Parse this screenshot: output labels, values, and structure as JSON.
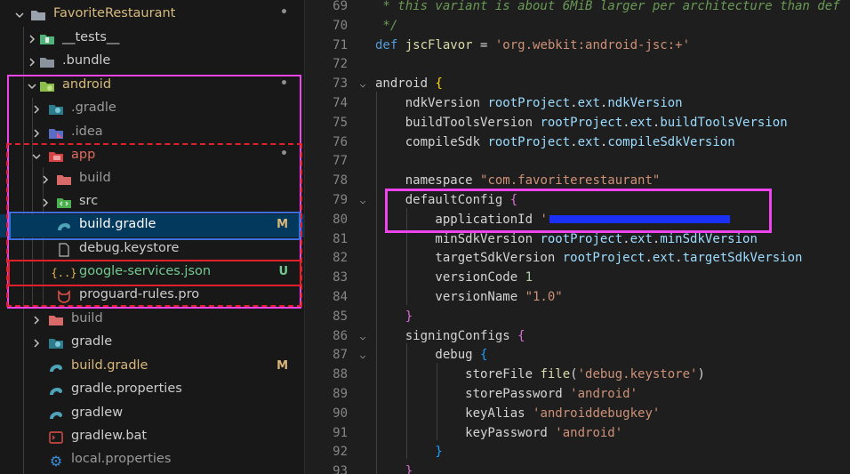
{
  "explorer": {
    "items": [
      {
        "label": "FavoriteRestaurant",
        "icon": "folder-open-icon",
        "status": "•"
      },
      {
        "label": "__tests__",
        "icon": "test-folder-icon",
        "status": ""
      },
      {
        "label": ".bundle",
        "icon": "folder-icon",
        "status": ""
      },
      {
        "label": "android",
        "icon": "android-folder-icon",
        "status": "•"
      },
      {
        "label": ".gradle",
        "icon": "gradle-folder-icon",
        "status": ""
      },
      {
        "label": ".idea",
        "icon": "idea-folder-icon",
        "status": ""
      },
      {
        "label": "app",
        "icon": "app-folder-icon",
        "status": "•"
      },
      {
        "label": "build",
        "icon": "build-folder-icon",
        "status": ""
      },
      {
        "label": "src",
        "icon": "src-folder-icon",
        "status": ""
      },
      {
        "label": "build.gradle",
        "icon": "gradle-file-icon",
        "status": "M"
      },
      {
        "label": "debug.keystore",
        "icon": "file-icon",
        "status": ""
      },
      {
        "label": "google-services.json",
        "icon": "json-file-icon",
        "status": "U"
      },
      {
        "label": "proguard-rules.pro",
        "icon": "proguard-file-icon",
        "status": ""
      },
      {
        "label": "build",
        "icon": "build-folder-icon",
        "status": ""
      },
      {
        "label": "gradle",
        "icon": "gradle-folder-icon",
        "status": ""
      },
      {
        "label": "build.gradle",
        "icon": "gradle-file-icon",
        "status": "M"
      },
      {
        "label": "gradle.properties",
        "icon": "gradle-file-icon",
        "status": ""
      },
      {
        "label": "gradlew",
        "icon": "gradle-file-icon",
        "status": ""
      },
      {
        "label": "gradlew.bat",
        "icon": "terminal-file-icon",
        "status": ""
      },
      {
        "label": "local.properties",
        "icon": "gear-icon",
        "status": ""
      }
    ]
  },
  "editor": {
    "lines": [
      {
        "num": "69",
        "t": [
          [
            "cm",
            " * this variant is about 6MiB larger per architecture than def"
          ]
        ]
      },
      {
        "num": "70",
        "t": [
          [
            "cm",
            " */"
          ]
        ]
      },
      {
        "num": "71",
        "t": [
          [
            "k",
            "def "
          ],
          [
            "f",
            "jscFlavor"
          ],
          [
            "p",
            " = "
          ],
          [
            "s",
            "'org.webkit:android-jsc:+'"
          ]
        ]
      },
      {
        "num": "72",
        "t": []
      },
      {
        "num": "73",
        "t": [
          [
            "p",
            "android "
          ],
          [
            "br",
            "{"
          ]
        ]
      },
      {
        "num": "74",
        "t": [
          [
            "p",
            "    ndkVersion "
          ],
          [
            "v",
            "rootProject"
          ],
          [
            "p",
            "."
          ],
          [
            "v",
            "ext"
          ],
          [
            "p",
            "."
          ],
          [
            "v",
            "ndkVersion"
          ]
        ]
      },
      {
        "num": "75",
        "t": [
          [
            "p",
            "    buildToolsVersion "
          ],
          [
            "v",
            "rootProject"
          ],
          [
            "p",
            "."
          ],
          [
            "v",
            "ext"
          ],
          [
            "p",
            "."
          ],
          [
            "v",
            "buildToolsVersion"
          ]
        ]
      },
      {
        "num": "76",
        "t": [
          [
            "p",
            "    compileSdk "
          ],
          [
            "v",
            "rootProject"
          ],
          [
            "p",
            "."
          ],
          [
            "v",
            "ext"
          ],
          [
            "p",
            "."
          ],
          [
            "v",
            "compileSdkVersion"
          ]
        ]
      },
      {
        "num": "77",
        "t": []
      },
      {
        "num": "78",
        "t": [
          [
            "p",
            "    namespace "
          ],
          [
            "s",
            "\"com.favoriterestaurant\""
          ]
        ]
      },
      {
        "num": "79",
        "t": [
          [
            "p",
            "    defaultConfig "
          ],
          [
            "br2",
            "{"
          ]
        ]
      },
      {
        "num": "80",
        "t": [
          [
            "p",
            "        applicationId "
          ],
          [
            "s",
            "'"
          ],
          [
            "redact",
            ""
          ]
        ]
      },
      {
        "num": "81",
        "t": [
          [
            "p",
            "        minSdkVersion "
          ],
          [
            "v",
            "rootProject"
          ],
          [
            "p",
            "."
          ],
          [
            "v",
            "ext"
          ],
          [
            "p",
            "."
          ],
          [
            "v",
            "minSdkVersion"
          ]
        ]
      },
      {
        "num": "82",
        "t": [
          [
            "p",
            "        targetSdkVersion "
          ],
          [
            "v",
            "rootProject"
          ],
          [
            "p",
            "."
          ],
          [
            "v",
            "ext"
          ],
          [
            "p",
            "."
          ],
          [
            "v",
            "targetSdkVersion"
          ]
        ]
      },
      {
        "num": "83",
        "t": [
          [
            "p",
            "        versionCode "
          ],
          [
            "n",
            "1"
          ]
        ]
      },
      {
        "num": "84",
        "t": [
          [
            "p",
            "        versionName "
          ],
          [
            "s",
            "\"1.0\""
          ]
        ]
      },
      {
        "num": "85",
        "t": [
          [
            "br2",
            "    }"
          ]
        ]
      },
      {
        "num": "86",
        "t": [
          [
            "p",
            "    signingConfigs "
          ],
          [
            "br2",
            "{"
          ]
        ]
      },
      {
        "num": "87",
        "t": [
          [
            "p",
            "        debug "
          ],
          [
            "br3",
            "{"
          ]
        ]
      },
      {
        "num": "88",
        "t": [
          [
            "p",
            "            storeFile "
          ],
          [
            "f",
            "file"
          ],
          [
            "p",
            "("
          ],
          [
            "s",
            "'debug.keystore'"
          ],
          [
            "p",
            ")"
          ]
        ]
      },
      {
        "num": "89",
        "t": [
          [
            "p",
            "            storePassword "
          ],
          [
            "s",
            "'android'"
          ]
        ]
      },
      {
        "num": "90",
        "t": [
          [
            "p",
            "            keyAlias "
          ],
          [
            "s",
            "'androiddebugkey'"
          ]
        ]
      },
      {
        "num": "91",
        "t": [
          [
            "p",
            "            keyPassword "
          ],
          [
            "s",
            "'android'"
          ]
        ]
      },
      {
        "num": "92",
        "t": [
          [
            "br3",
            "        }"
          ]
        ]
      },
      {
        "num": "93",
        "t": [
          [
            "br2",
            "    }"
          ]
        ]
      }
    ]
  },
  "colors": {
    "annotation_magenta": "#ee44ee",
    "annotation_red": "#e0202a",
    "annotation_blue": "#3a6fe0",
    "selection": "#04395e"
  }
}
